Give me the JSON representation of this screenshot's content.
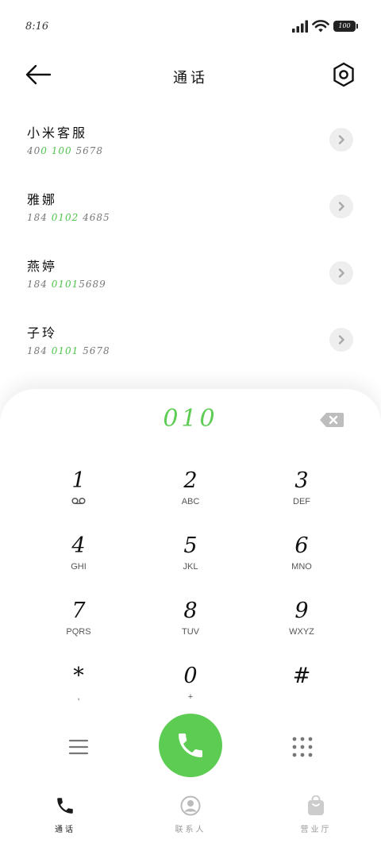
{
  "status_bar": {
    "time": "8:16",
    "battery": "100"
  },
  "header": {
    "title": "通话"
  },
  "contacts": [
    {
      "name": "小米客服",
      "num_pre": "40",
      "num_hl": "0 100",
      "num_post": " 5678"
    },
    {
      "name": "雅娜",
      "num_pre": "184 ",
      "num_hl": "0102",
      "num_post": " 4685"
    },
    {
      "name": "燕婷",
      "num_pre": "184 ",
      "num_hl": "0101",
      "num_post": "5689"
    },
    {
      "name": "子玲",
      "num_pre": "184 ",
      "num_hl": "0101",
      "num_post": " 5678"
    }
  ],
  "dialer": {
    "entry": "010",
    "keys": [
      {
        "digit": "1",
        "letters": ""
      },
      {
        "digit": "2",
        "letters": "ABC"
      },
      {
        "digit": "3",
        "letters": "DEF"
      },
      {
        "digit": "4",
        "letters": "GHI"
      },
      {
        "digit": "5",
        "letters": "JKL"
      },
      {
        "digit": "6",
        "letters": "MNO"
      },
      {
        "digit": "7",
        "letters": "PQRS"
      },
      {
        "digit": "8",
        "letters": "TUV"
      },
      {
        "digit": "9",
        "letters": "WXYZ"
      },
      {
        "digit": "*",
        "letters": ","
      },
      {
        "digit": "0",
        "letters": "+"
      },
      {
        "digit": "#",
        "letters": ""
      }
    ]
  },
  "bottom_nav": [
    {
      "label": "通话",
      "icon": "phone-icon"
    },
    {
      "label": "联系人",
      "icon": "contact-icon"
    },
    {
      "label": "营业厅",
      "icon": "bag-icon"
    }
  ],
  "colors": {
    "accent": "#5ccc52",
    "highlight": "#4fc44b"
  }
}
